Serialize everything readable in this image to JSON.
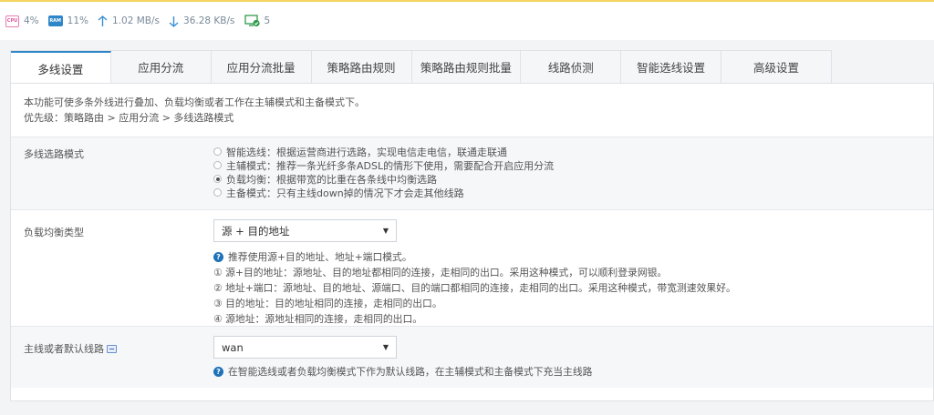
{
  "stats": {
    "cpu_label": "CPU",
    "cpu": "4%",
    "ram_label": "RAM",
    "ram": "11%",
    "upload": "1.02 MB/s",
    "download": "36.28 KB/s",
    "devices": "5"
  },
  "tabs": [
    {
      "label": "多线设置",
      "active": true
    },
    {
      "label": "应用分流"
    },
    {
      "label": "应用分流批量"
    },
    {
      "label": "策略路由规则"
    },
    {
      "label": "策略路由规则批量"
    },
    {
      "label": "线路侦测"
    },
    {
      "label": "智能选线设置"
    },
    {
      "label": "高级设置"
    }
  ],
  "intro": {
    "line1": "本功能可使多条外线进行叠加、负载均衡或者工作在主辅模式和主备模式下。",
    "line2": "优先级：策略路由 > 应用分流 > 多线选路模式"
  },
  "mode": {
    "label": "多线选路模式",
    "options": [
      "智能选线：根据运营商进行选路，实现电信走电信，联通走联通",
      "主辅模式：推荐一条光纤多条ADSL的情形下使用，需要配合开启应用分流",
      "负载均衡：根据带宽的比重在各条线中均衡选路",
      "主备模式：只有主线down掉的情况下才会走其他线路"
    ],
    "selected_index": 2
  },
  "balance": {
    "label": "负载均衡类型",
    "selected": "源 + 目的地址",
    "hint": "推荐使用源+目的地址、地址+端口模式。",
    "notes": [
      "① 源+目的地址：源地址、目的地址都相同的连接，走相同的出口。采用这种模式，可以顺利登录网银。",
      "② 地址+端口：源地址、目的地址、源端口、目的端口都相同的连接，走相同的出口。采用这种模式，带宽测速效果好。",
      "③ 目的地址：目的地址相同的连接，走相同的出口。",
      "④ 源地址：源地址相同的连接，走相同的出口。"
    ]
  },
  "default_line": {
    "label": "主线或者默认线路",
    "selected": "wan",
    "hint": "在智能选线或者负载均衡模式下作为默认线路，在主辅模式和主备模式下充当主线路"
  },
  "colors": {
    "accent": "#2e86c9",
    "help_icon": "#1f72b8",
    "top_border": "#f4d35e"
  }
}
